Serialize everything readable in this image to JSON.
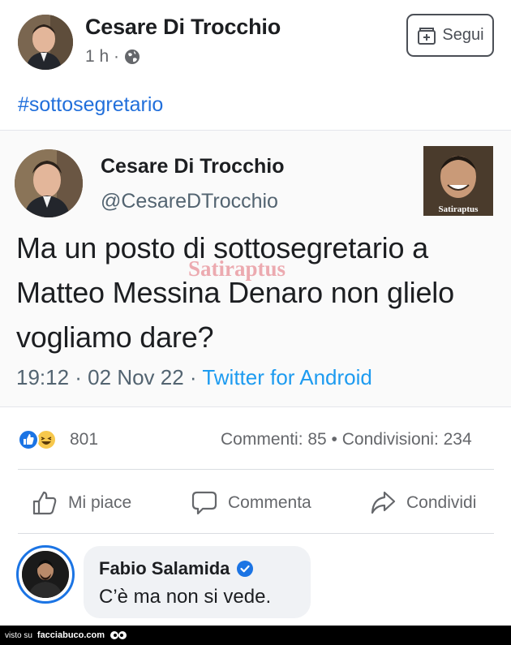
{
  "post": {
    "author": "Cesare Di Trocchio",
    "time": "1 h ·",
    "follow_label": "Segui",
    "hashtag": "#sottosegretario"
  },
  "tweet": {
    "author": "Cesare Di Trocchio",
    "handle": "@CesareDTrocchio",
    "text": "Ma un posto di sottosegretario a Matteo Messina Denaro non glielo vogliamo dare?",
    "date": "19:12 · 02 Nov 22 · ",
    "source": "Twitter for Android",
    "watermark": "Satiraptus",
    "thumb_label": "Satiraptus"
  },
  "stats": {
    "reaction_count": "801",
    "engagement": "Commenti: 85 • Condivisioni: 234"
  },
  "actions": {
    "like": "Mi piace",
    "comment": "Commenta",
    "share": "Condividi"
  },
  "comment": {
    "author": "Fabio Salamida",
    "text": "C’è ma non si vede."
  },
  "footer": {
    "prefix": "visto su",
    "site": "facciabuco.com"
  },
  "colors": {
    "link_blue": "#216fdb",
    "twitter_blue": "#1d9bf0",
    "like_blue": "#1b74e4",
    "muted_text": "#65676b"
  }
}
